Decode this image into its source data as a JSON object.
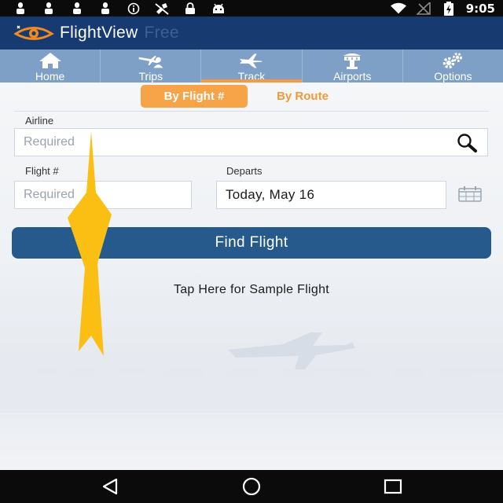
{
  "status_bar": {
    "time": "9:05",
    "left_icons": [
      "notification-icon",
      "notification-icon",
      "notification-icon",
      "notification-icon",
      "info-icon",
      "satellite-off-icon",
      "lock-icon",
      "android-icon"
    ],
    "right_icons": [
      "wifi-icon",
      "signal-off-icon",
      "battery-charging-icon"
    ]
  },
  "app_bar": {
    "name": "FlightView",
    "edition": "Free",
    "logo_icon": "eye-logo-icon"
  },
  "tabs": [
    {
      "label": "Home",
      "icon": "home-icon",
      "active": false
    },
    {
      "label": "Trips",
      "icon": "trips-icon",
      "active": false
    },
    {
      "label": "Track",
      "icon": "plane-icon",
      "active": true
    },
    {
      "label": "Airports",
      "icon": "airport-icon",
      "active": false
    },
    {
      "label": "Options",
      "icon": "gears-icon",
      "active": false
    }
  ],
  "search_mode": {
    "by_flight_label": "By Flight #",
    "by_route_label": "By Route",
    "selected": "By Flight #"
  },
  "form": {
    "airline_label": "Airline",
    "airline_placeholder": "Required",
    "flight_label": "Flight #",
    "flight_placeholder": "Required",
    "departs_label": "Departs",
    "departs_value": "Today, May 16"
  },
  "find_button_label": "Find Flight",
  "sample_flight_link": "Tap Here for Sample Flight",
  "colors": {
    "app_bar": "#173b70",
    "tab_bar": "#7ea0c6",
    "accent_orange": "#f7a348",
    "find_button": "#265a8c"
  },
  "nav_bar": {
    "icons": [
      "back-icon",
      "home-circle-icon",
      "recents-icon"
    ]
  }
}
